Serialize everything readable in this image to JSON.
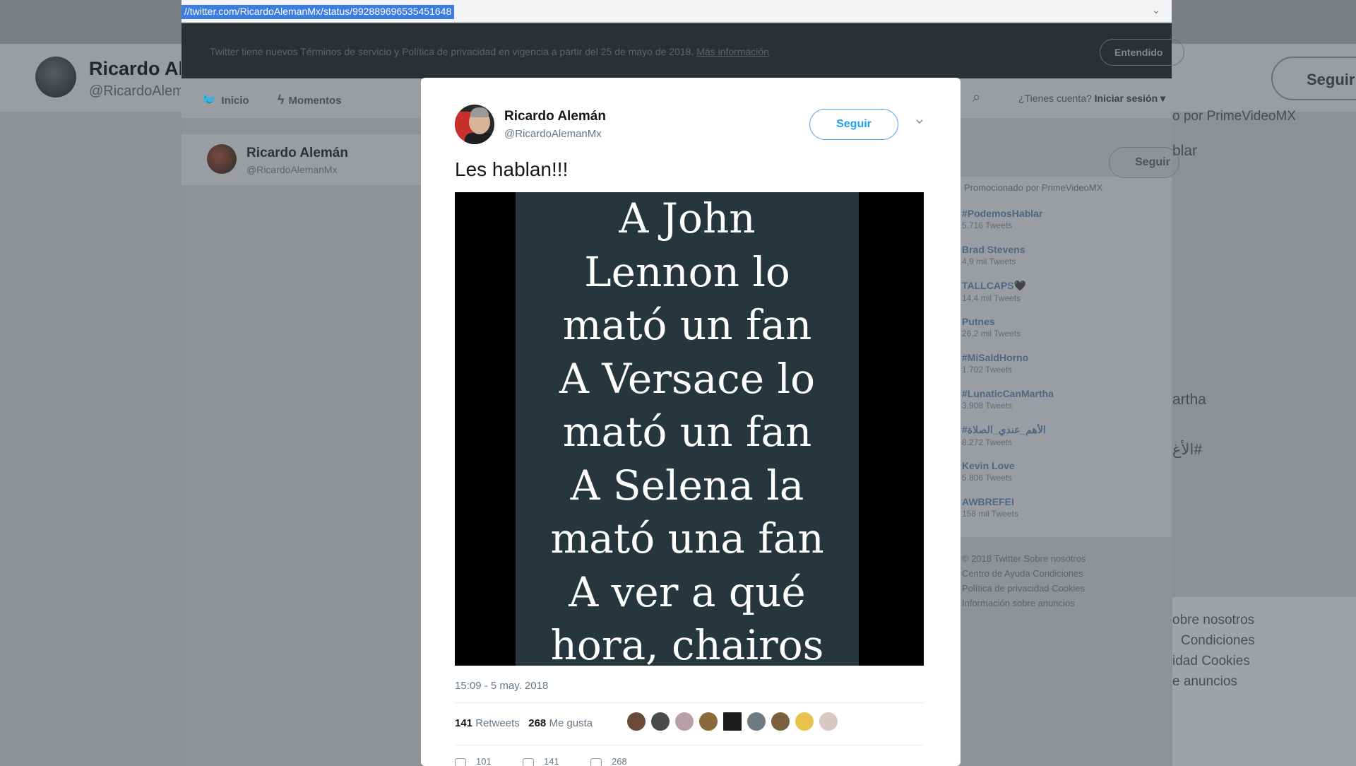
{
  "browser": {
    "address_url": "//twitter.com/RicardoAlemanMx/status/992889696535451648"
  },
  "notice": {
    "text": "Twitter tiene nuevos Términos de servicio y Política de privacidad en vigencia a partir del 25 de mayo de 2018.",
    "link": "Más información",
    "button": "Entendido"
  },
  "nav": {
    "home": "Inicio",
    "moments": "Momentos",
    "login_prompt": "¿Tienes cuenta?",
    "login": "Iniciar sesión ▾"
  },
  "profile_card": {
    "name": "Ricardo Alemán",
    "handle": "@RicardoAlemanMx"
  },
  "outer_profile": {
    "name": "Ricardo Alemán",
    "handle": "@RicardoAlemanMx",
    "follow": "Seguir",
    "promoted_by": "o por PrimeVideoMX",
    "label_hablar": "blar",
    "label_martha": "artha",
    "label_arabic": "الأغ#",
    "footer_lines": [
      "obre nosotros",
      "Condiciones",
      "idad  Cookies",
      "e anuncios"
    ]
  },
  "trends": {
    "promoted": "Promocionado por PrimeVideoMX",
    "items": [
      {
        "name": "#PodemosHablar",
        "count": "5.716 Tweets"
      },
      {
        "name": "Brad Stevens",
        "count": "4,9 mil Tweets"
      },
      {
        "name": "TALLCAPS🖤",
        "count": "14,4 mil Tweets"
      },
      {
        "name": "Putnes",
        "count": "26,2 mil Tweets"
      },
      {
        "name": "#MiSaldHorno",
        "count": "1.702 Tweets"
      },
      {
        "name": "#LunaticCanMartha",
        "count": "3.908 Tweets"
      },
      {
        "name": "#الأهم_عندي_الصلاة",
        "count": "8.272 Tweets"
      },
      {
        "name": "Kevin Love",
        "count": "5.806 Tweets"
      },
      {
        "name": "AWBREFEI",
        "count": "158 mil Tweets"
      }
    ],
    "follow": "Seguir",
    "footer": [
      "© 2018 Twitter   Sobre nosotros",
      "Centro de Ayuda   Condiciones",
      "Política de privacidad   Cookies",
      "Información sobre anuncios"
    ]
  },
  "tweet": {
    "author_name": "Ricardo Alemán",
    "author_handle": "@RicardoAlemanMx",
    "follow_label": "Seguir",
    "text": "Les hablan!!!",
    "image_lines": [
      "A John",
      "Lennon lo",
      "mató un fan",
      "A Versace lo",
      "mató un fan",
      "A Selena la",
      "mató una fan",
      "A ver a qué",
      "hora, chairos"
    ],
    "timestamp": "15:09 - 5 may. 2018",
    "retweets_count": "141",
    "retweets_label": "Retweets",
    "likes_count": "268",
    "likes_label": "Me gusta",
    "actions": {
      "replies": "101",
      "retweets": "141",
      "likes": "268"
    }
  },
  "colors": {
    "accent": "#1da1f2",
    "notice_bg": "#2b3035",
    "image_bg": "#25363c"
  }
}
